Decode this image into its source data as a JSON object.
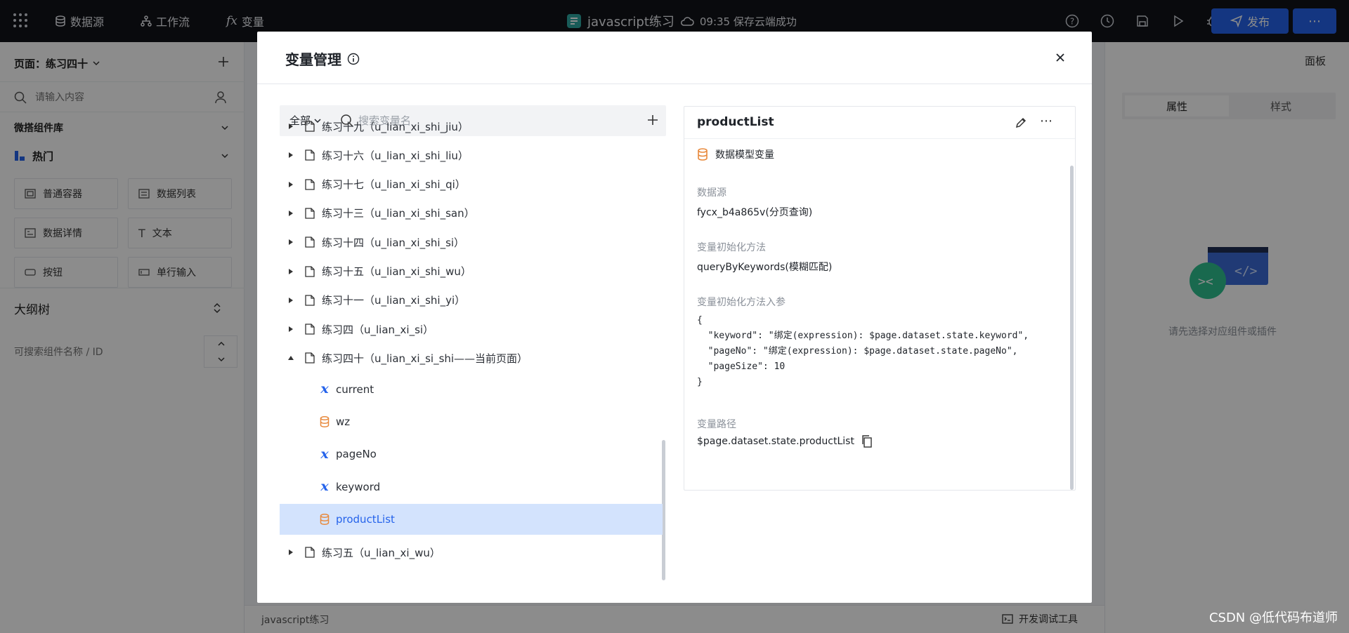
{
  "topbar": {
    "nav": [
      "数据源",
      "工作流",
      "变量"
    ],
    "doc_title": "javascript练习",
    "save_status": "09:35 保存云端成功",
    "publish_label": "发布"
  },
  "left_panel": {
    "page_label": "页面：练习四十",
    "search_placeholder": "请输入内容",
    "lib_title": "微搭组件库",
    "group_title": "热门",
    "components": [
      "普通容器",
      "数据列表",
      "数据详情",
      "文本",
      "按钮",
      "单行输入"
    ],
    "outline_title": "大纲树",
    "outline_placeholder": "可搜索组件名称 / ID"
  },
  "right_panel": {
    "panel_label": "面板",
    "tabs": [
      "属性",
      "样式"
    ],
    "empty_hint": "请先选择对应组件或插件"
  },
  "bottom_bar": {
    "doc_name": "javascript练习",
    "devtools_label": "开发调试工具"
  },
  "modal": {
    "title": "变量管理",
    "filter_label": "全部",
    "search_placeholder": "搜索变量名",
    "tree": [
      {
        "label": "练习十九（u_lian_xi_shi_jiu）",
        "expanded": false
      },
      {
        "label": "练习十六（u_lian_xi_shi_liu）",
        "expanded": false
      },
      {
        "label": "练习十七（u_lian_xi_shi_qi）",
        "expanded": false
      },
      {
        "label": "练习十三（u_lian_xi_shi_san）",
        "expanded": false
      },
      {
        "label": "练习十四（u_lian_xi_shi_si）",
        "expanded": false
      },
      {
        "label": "练习十五（u_lian_xi_shi_wu）",
        "expanded": false
      },
      {
        "label": "练习十一（u_lian_xi_shi_yi）",
        "expanded": false
      },
      {
        "label": "练习四（u_lian_xi_si）",
        "expanded": false
      },
      {
        "label": "练习四十（u_lian_xi_si_shi——当前页面）",
        "expanded": true
      },
      {
        "label": "练习五（u_lian_xi_wu）",
        "expanded": false
      }
    ],
    "variables": [
      {
        "name": "current",
        "icon": "variable-x-icon"
      },
      {
        "name": "wz",
        "icon": "database-icon"
      },
      {
        "name": "pageNo",
        "icon": "variable-x-icon"
      },
      {
        "name": "keyword",
        "icon": "variable-x-icon"
      },
      {
        "name": "productList",
        "icon": "database-icon",
        "selected": true
      }
    ],
    "detail": {
      "name": "productList",
      "type_label": "数据模型变量",
      "datasource_label": "数据源",
      "datasource_value": "fycx_b4a865v(分页查询)",
      "init_method_label": "变量初始化方法",
      "init_method_value": "queryByKeywords(模糊匹配)",
      "init_params_label": "变量初始化方法入参",
      "init_params_lines": [
        "{",
        "  \"keyword\": \"绑定(expression): $page.dataset.state.keyword\",",
        "  \"pageNo\": \"绑定(expression): $page.dataset.state.pageNo\",",
        "  \"pageSize\": 10",
        "}"
      ],
      "path_label": "变量路径",
      "path_value": "$page.dataset.state.productList"
    }
  },
  "watermark": "CSDN @低代码布道师",
  "colors": {
    "accent": "#2563eb",
    "selected_bg": "#d3e3fd",
    "db_icon": "#e8893c"
  }
}
